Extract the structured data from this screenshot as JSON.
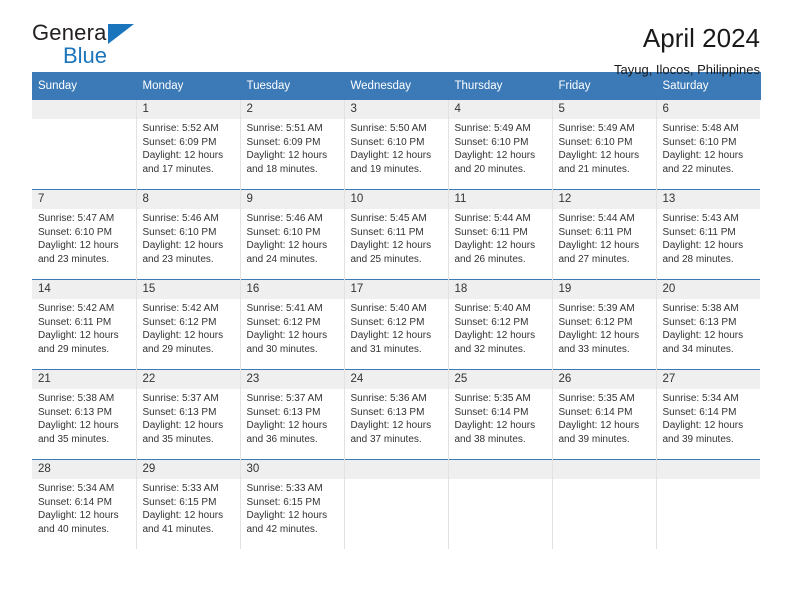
{
  "brand": {
    "name_top": "General",
    "name_bottom": "Blue",
    "accent_color": "#1b75bc"
  },
  "header": {
    "title": "April 2024",
    "subtitle": "Tayug, Ilocos, Philippines"
  },
  "calendar": {
    "header_bg": "#3b79b7",
    "daynum_bg": "#efefef",
    "weekday_labels": [
      "Sunday",
      "Monday",
      "Tuesday",
      "Wednesday",
      "Thursday",
      "Friday",
      "Saturday"
    ],
    "weeks": [
      [
        {
          "day": "",
          "sunrise": "",
          "sunset": "",
          "daylight_line1": "",
          "daylight_line2": ""
        },
        {
          "day": "1",
          "sunrise": "Sunrise: 5:52 AM",
          "sunset": "Sunset: 6:09 PM",
          "daylight_line1": "Daylight: 12 hours",
          "daylight_line2": "and 17 minutes."
        },
        {
          "day": "2",
          "sunrise": "Sunrise: 5:51 AM",
          "sunset": "Sunset: 6:09 PM",
          "daylight_line1": "Daylight: 12 hours",
          "daylight_line2": "and 18 minutes."
        },
        {
          "day": "3",
          "sunrise": "Sunrise: 5:50 AM",
          "sunset": "Sunset: 6:10 PM",
          "daylight_line1": "Daylight: 12 hours",
          "daylight_line2": "and 19 minutes."
        },
        {
          "day": "4",
          "sunrise": "Sunrise: 5:49 AM",
          "sunset": "Sunset: 6:10 PM",
          "daylight_line1": "Daylight: 12 hours",
          "daylight_line2": "and 20 minutes."
        },
        {
          "day": "5",
          "sunrise": "Sunrise: 5:49 AM",
          "sunset": "Sunset: 6:10 PM",
          "daylight_line1": "Daylight: 12 hours",
          "daylight_line2": "and 21 minutes."
        },
        {
          "day": "6",
          "sunrise": "Sunrise: 5:48 AM",
          "sunset": "Sunset: 6:10 PM",
          "daylight_line1": "Daylight: 12 hours",
          "daylight_line2": "and 22 minutes."
        }
      ],
      [
        {
          "day": "7",
          "sunrise": "Sunrise: 5:47 AM",
          "sunset": "Sunset: 6:10 PM",
          "daylight_line1": "Daylight: 12 hours",
          "daylight_line2": "and 23 minutes."
        },
        {
          "day": "8",
          "sunrise": "Sunrise: 5:46 AM",
          "sunset": "Sunset: 6:10 PM",
          "daylight_line1": "Daylight: 12 hours",
          "daylight_line2": "and 23 minutes."
        },
        {
          "day": "9",
          "sunrise": "Sunrise: 5:46 AM",
          "sunset": "Sunset: 6:10 PM",
          "daylight_line1": "Daylight: 12 hours",
          "daylight_line2": "and 24 minutes."
        },
        {
          "day": "10",
          "sunrise": "Sunrise: 5:45 AM",
          "sunset": "Sunset: 6:11 PM",
          "daylight_line1": "Daylight: 12 hours",
          "daylight_line2": "and 25 minutes."
        },
        {
          "day": "11",
          "sunrise": "Sunrise: 5:44 AM",
          "sunset": "Sunset: 6:11 PM",
          "daylight_line1": "Daylight: 12 hours",
          "daylight_line2": "and 26 minutes."
        },
        {
          "day": "12",
          "sunrise": "Sunrise: 5:44 AM",
          "sunset": "Sunset: 6:11 PM",
          "daylight_line1": "Daylight: 12 hours",
          "daylight_line2": "and 27 minutes."
        },
        {
          "day": "13",
          "sunrise": "Sunrise: 5:43 AM",
          "sunset": "Sunset: 6:11 PM",
          "daylight_line1": "Daylight: 12 hours",
          "daylight_line2": "and 28 minutes."
        }
      ],
      [
        {
          "day": "14",
          "sunrise": "Sunrise: 5:42 AM",
          "sunset": "Sunset: 6:11 PM",
          "daylight_line1": "Daylight: 12 hours",
          "daylight_line2": "and 29 minutes."
        },
        {
          "day": "15",
          "sunrise": "Sunrise: 5:42 AM",
          "sunset": "Sunset: 6:12 PM",
          "daylight_line1": "Daylight: 12 hours",
          "daylight_line2": "and 29 minutes."
        },
        {
          "day": "16",
          "sunrise": "Sunrise: 5:41 AM",
          "sunset": "Sunset: 6:12 PM",
          "daylight_line1": "Daylight: 12 hours",
          "daylight_line2": "and 30 minutes."
        },
        {
          "day": "17",
          "sunrise": "Sunrise: 5:40 AM",
          "sunset": "Sunset: 6:12 PM",
          "daylight_line1": "Daylight: 12 hours",
          "daylight_line2": "and 31 minutes."
        },
        {
          "day": "18",
          "sunrise": "Sunrise: 5:40 AM",
          "sunset": "Sunset: 6:12 PM",
          "daylight_line1": "Daylight: 12 hours",
          "daylight_line2": "and 32 minutes."
        },
        {
          "day": "19",
          "sunrise": "Sunrise: 5:39 AM",
          "sunset": "Sunset: 6:12 PM",
          "daylight_line1": "Daylight: 12 hours",
          "daylight_line2": "and 33 minutes."
        },
        {
          "day": "20",
          "sunrise": "Sunrise: 5:38 AM",
          "sunset": "Sunset: 6:13 PM",
          "daylight_line1": "Daylight: 12 hours",
          "daylight_line2": "and 34 minutes."
        }
      ],
      [
        {
          "day": "21",
          "sunrise": "Sunrise: 5:38 AM",
          "sunset": "Sunset: 6:13 PM",
          "daylight_line1": "Daylight: 12 hours",
          "daylight_line2": "and 35 minutes."
        },
        {
          "day": "22",
          "sunrise": "Sunrise: 5:37 AM",
          "sunset": "Sunset: 6:13 PM",
          "daylight_line1": "Daylight: 12 hours",
          "daylight_line2": "and 35 minutes."
        },
        {
          "day": "23",
          "sunrise": "Sunrise: 5:37 AM",
          "sunset": "Sunset: 6:13 PM",
          "daylight_line1": "Daylight: 12 hours",
          "daylight_line2": "and 36 minutes."
        },
        {
          "day": "24",
          "sunrise": "Sunrise: 5:36 AM",
          "sunset": "Sunset: 6:13 PM",
          "daylight_line1": "Daylight: 12 hours",
          "daylight_line2": "and 37 minutes."
        },
        {
          "day": "25",
          "sunrise": "Sunrise: 5:35 AM",
          "sunset": "Sunset: 6:14 PM",
          "daylight_line1": "Daylight: 12 hours",
          "daylight_line2": "and 38 minutes."
        },
        {
          "day": "26",
          "sunrise": "Sunrise: 5:35 AM",
          "sunset": "Sunset: 6:14 PM",
          "daylight_line1": "Daylight: 12 hours",
          "daylight_line2": "and 39 minutes."
        },
        {
          "day": "27",
          "sunrise": "Sunrise: 5:34 AM",
          "sunset": "Sunset: 6:14 PM",
          "daylight_line1": "Daylight: 12 hours",
          "daylight_line2": "and 39 minutes."
        }
      ],
      [
        {
          "day": "28",
          "sunrise": "Sunrise: 5:34 AM",
          "sunset": "Sunset: 6:14 PM",
          "daylight_line1": "Daylight: 12 hours",
          "daylight_line2": "and 40 minutes."
        },
        {
          "day": "29",
          "sunrise": "Sunrise: 5:33 AM",
          "sunset": "Sunset: 6:15 PM",
          "daylight_line1": "Daylight: 12 hours",
          "daylight_line2": "and 41 minutes."
        },
        {
          "day": "30",
          "sunrise": "Sunrise: 5:33 AM",
          "sunset": "Sunset: 6:15 PM",
          "daylight_line1": "Daylight: 12 hours",
          "daylight_line2": "and 42 minutes."
        },
        {
          "day": "",
          "sunrise": "",
          "sunset": "",
          "daylight_line1": "",
          "daylight_line2": ""
        },
        {
          "day": "",
          "sunrise": "",
          "sunset": "",
          "daylight_line1": "",
          "daylight_line2": ""
        },
        {
          "day": "",
          "sunrise": "",
          "sunset": "",
          "daylight_line1": "",
          "daylight_line2": ""
        },
        {
          "day": "",
          "sunrise": "",
          "sunset": "",
          "daylight_line1": "",
          "daylight_line2": ""
        }
      ]
    ]
  }
}
